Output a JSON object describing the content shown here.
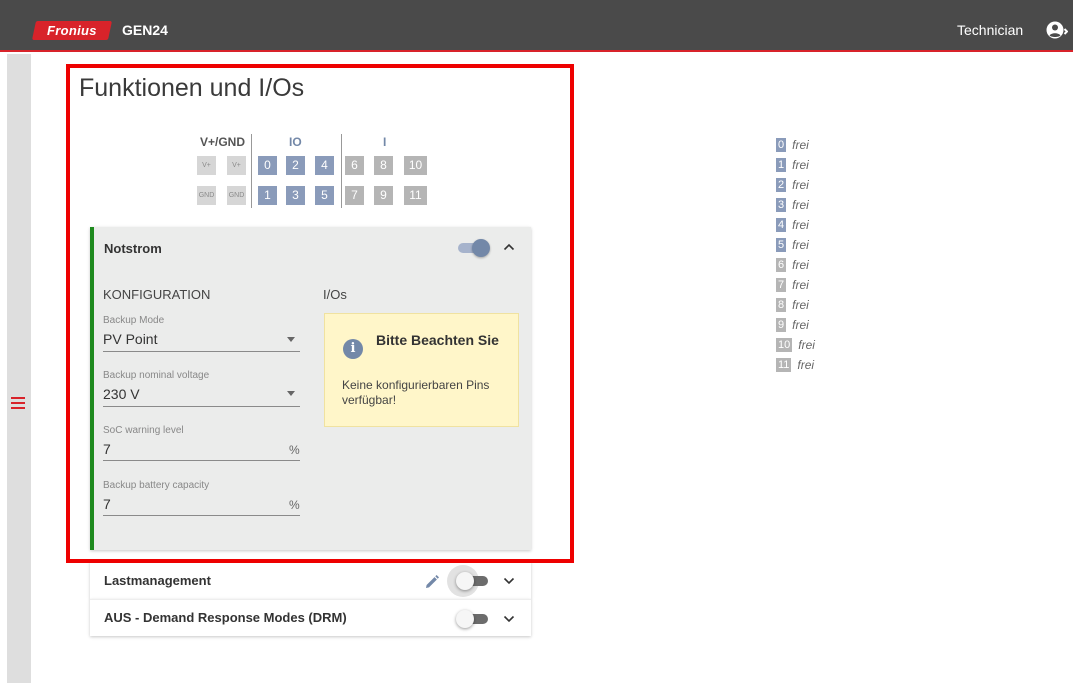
{
  "header": {
    "logo_text": "Fronius",
    "app_name": "GEN24",
    "user_name": "Technician",
    "brand_color": "#d8232a",
    "bar_color": "#4a4a4a"
  },
  "page": {
    "title": "Funktionen und I/Os"
  },
  "pin_map": {
    "groups": [
      "V+/GND",
      "IO",
      "I"
    ],
    "vplus_label": "V+",
    "gnd_label": "GND",
    "io_top": [
      "0",
      "2",
      "4"
    ],
    "io_bottom": [
      "1",
      "3",
      "5"
    ],
    "i_top": [
      "6",
      "8",
      "10"
    ],
    "i_bottom": [
      "7",
      "9",
      "11"
    ]
  },
  "notstrom": {
    "title": "Notstrom",
    "enabled": true,
    "config_heading": "KONFIGURATION",
    "ios_heading": "I/Os",
    "fields": [
      {
        "label": "Backup Mode",
        "value": "PV Point",
        "type": "select"
      },
      {
        "label": "Backup nominal voltage",
        "value": "230 V",
        "type": "select"
      },
      {
        "label": "SoC warning level",
        "value": "7",
        "unit": "%",
        "type": "number"
      },
      {
        "label": "Backup battery capacity",
        "value": "7",
        "unit": "%",
        "type": "number"
      }
    ],
    "notice": {
      "title": "Bitte Beachten Sie",
      "text": "Keine konfigurierbaren Pins verfügbar!",
      "icon": "info-icon"
    },
    "accent_color": "#1e8a1e"
  },
  "lastmanagement": {
    "title": "Lastmanagement",
    "enabled": false
  },
  "drm": {
    "title": "AUS - Demand Response Modes (DRM)",
    "enabled": false
  },
  "pin_list": [
    {
      "pin": "0",
      "state": "frei"
    },
    {
      "pin": "1",
      "state": "frei"
    },
    {
      "pin": "2",
      "state": "frei"
    },
    {
      "pin": "3",
      "state": "frei"
    },
    {
      "pin": "4",
      "state": "frei"
    },
    {
      "pin": "5",
      "state": "frei"
    },
    {
      "pin": "6",
      "state": "frei"
    },
    {
      "pin": "7",
      "state": "frei"
    },
    {
      "pin": "8",
      "state": "frei"
    },
    {
      "pin": "9",
      "state": "frei"
    },
    {
      "pin": "10",
      "state": "frei"
    },
    {
      "pin": "11",
      "state": "frei"
    }
  ]
}
